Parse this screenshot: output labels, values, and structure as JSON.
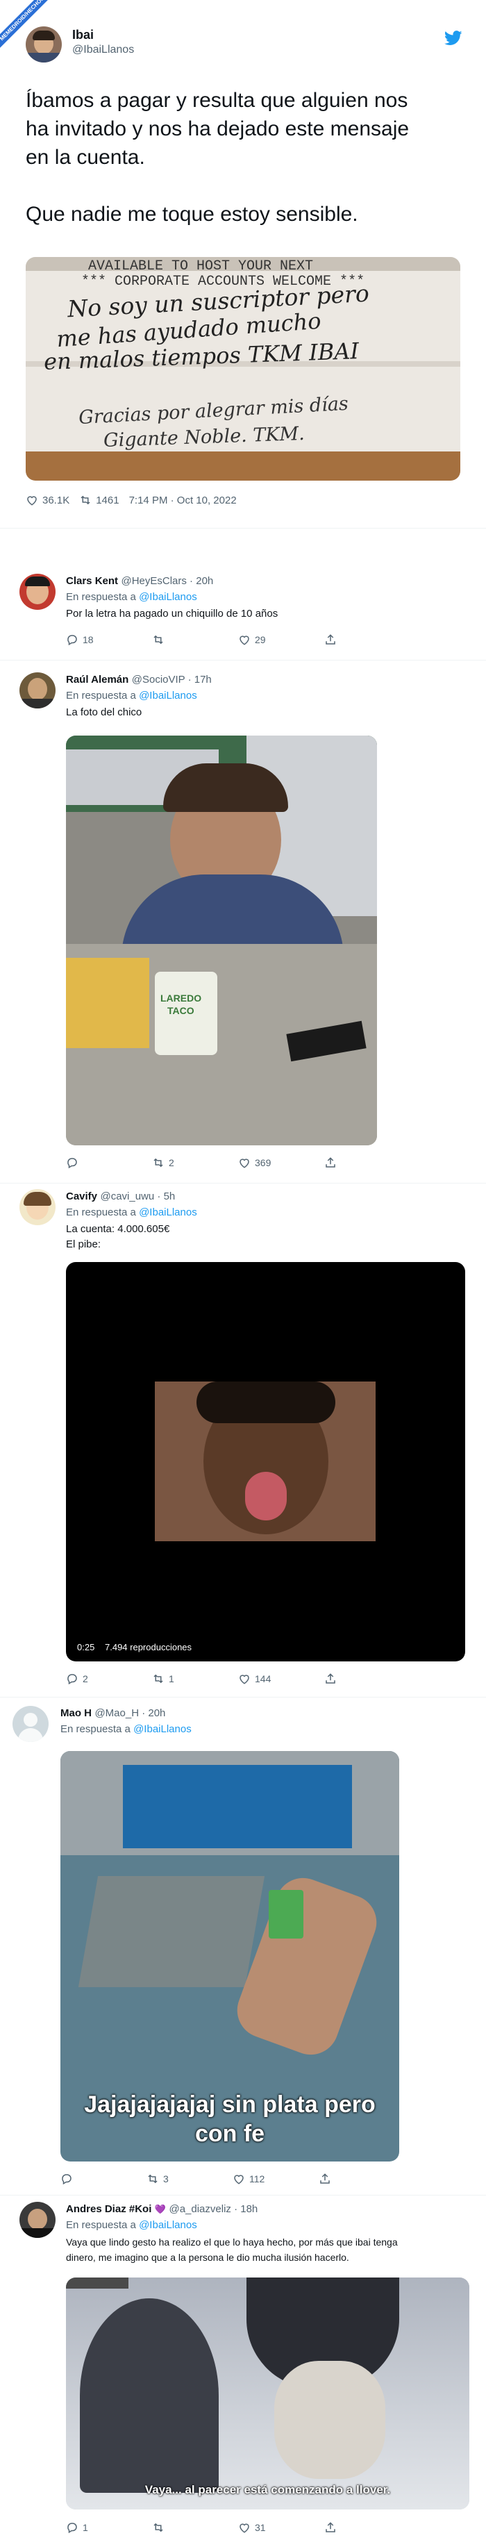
{
  "watermark": "MEMEDROID/HECHOS",
  "tweet": {
    "author": "Ibai",
    "handle": "@IbaiLlanos",
    "text_line1": "Íbamos a pagar y resulta que alguien nos",
    "text_line2": "ha invitado y nos ha dejado este mensaje",
    "text_line3": "en la cuenta.",
    "text_line4": "Que nadie me toque estoy sensible.",
    "note_top1": "AVAILABLE TO HOST YOUR NEXT",
    "note_top2": "*** CORPORATE ACCOUNTS WELCOME ***",
    "note_hand1": "No soy un suscriptor pero",
    "note_hand2": "me has ayudado mucho",
    "note_hand3": "en malos tiempos TKM IBAI",
    "note_hand4": "Gracias por alegrar mis días",
    "note_hand5": "Gigante Noble. TKM.",
    "likes": "36.1K",
    "retweets": "1461",
    "time": "7:14 PM · Oct 10, 2022"
  },
  "replies": [
    {
      "name": "Clars Kent",
      "handle": "@HeyEsClars · 20h",
      "replying": "En respuesta a",
      "to": "@IbaiLlanos",
      "text": "Por la letra ha pagado un chiquillo de 10 años",
      "comments": "18",
      "retweets": "",
      "likes": "29"
    },
    {
      "name": "Raúl Alemán",
      "handle": "@SocioVIP · 17h",
      "replying": "En respuesta a",
      "to": "@IbaiLlanos",
      "text": "La foto del chico",
      "comments": "",
      "retweets": "2",
      "likes": "369",
      "cup_text1": "LAREDO",
      "cup_text2": "TACO"
    },
    {
      "name": "Cavify",
      "handle": "@cavi_uwu · 5h",
      "replying": "En respuesta a",
      "to": "@IbaiLlanos",
      "text1": "La cuenta: 4.000.605€",
      "text2": "El pibe:",
      "video_time": "0:25",
      "video_views": "7.494 reproducciones",
      "comments": "2",
      "retweets": "1",
      "likes": "144"
    },
    {
      "name": "Mao H",
      "handle": "@Mao_H · 20h",
      "replying": "En respuesta a",
      "to": "@IbaiLlanos",
      "caption1": "Jajajajajajaj sin plata pero",
      "caption2": "con fe",
      "comments": "",
      "retweets": "3",
      "likes": "112"
    },
    {
      "name": "Andres Diaz #Koi",
      "heart": "💜",
      "handle": "@a_diazveliz · 18h",
      "replying": "En respuesta a",
      "to": "@IbaiLlanos",
      "text1": "Vaya que lindo gesto ha realizo el que lo haya hecho, por más que ibai tenga",
      "text2": "dinero, me imagino que a la persona le dio mucha ilusión hacerlo.",
      "caption": "Vaya... al parecer está comenzando a llover.",
      "comments": "1",
      "retweets": "",
      "likes": "31"
    }
  ],
  "colors": {
    "accent": "#1d9bf0",
    "text": "#0f1419",
    "muted": "#536471"
  }
}
